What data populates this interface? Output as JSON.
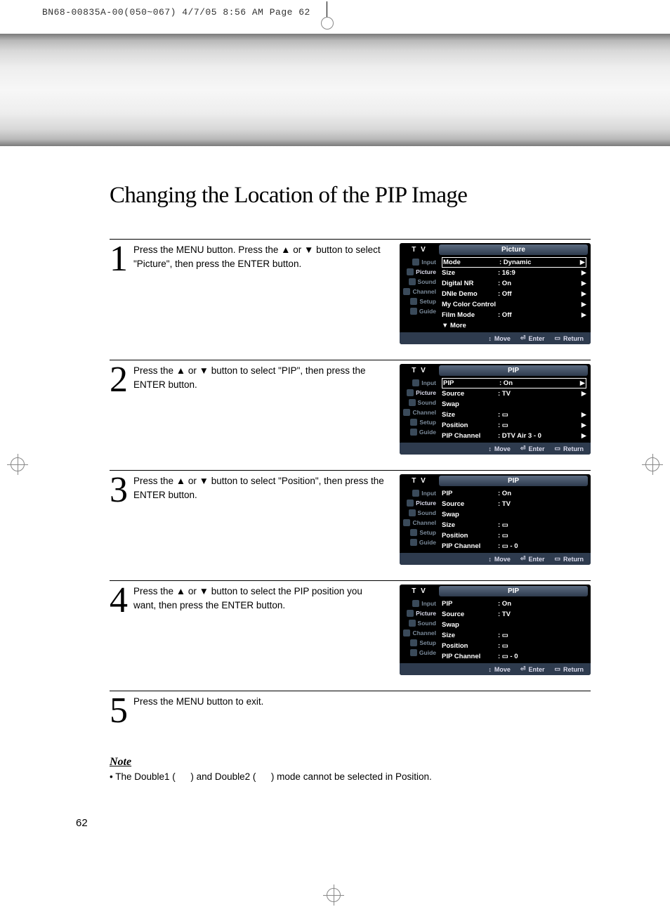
{
  "slug": "BN68-00835A-00(050~067)  4/7/05  8:56 AM  Page 62",
  "title": "Changing the Location of the PIP Image",
  "page_number": "62",
  "steps": [
    {
      "num": "1",
      "text": "Press the MENU button. Press the ▲ or ▼ button to select \"Picture\", then press the ENTER button.",
      "osd": {
        "tv": "T V",
        "title": "Picture",
        "side": [
          "Input",
          "Picture",
          "Sound",
          "Channel",
          "Setup",
          "Guide"
        ],
        "side_active": 1,
        "rows": [
          {
            "label": "Mode",
            "value": ": Dynamic",
            "arrow": "▶",
            "boxed": true
          },
          {
            "label": "Size",
            "value": ": 16:9",
            "arrow": "▶"
          },
          {
            "label": "Digital NR",
            "value": ": On",
            "arrow": "▶"
          },
          {
            "label": "DNIe Demo",
            "value": ": Off",
            "arrow": "▶"
          },
          {
            "label": "My Color Control",
            "value": "",
            "arrow": "▶"
          },
          {
            "label": "Film Mode",
            "value": ": Off",
            "arrow": "▶"
          },
          {
            "label": "▼ More",
            "value": "",
            "arrow": ""
          }
        ],
        "footer": [
          "Move",
          "Enter",
          "Return"
        ]
      }
    },
    {
      "num": "2",
      "text": "Press the ▲ or ▼ button to select \"PIP\", then press the ENTER button.",
      "osd": {
        "tv": "T V",
        "title": "PIP",
        "side": [
          "Input",
          "Picture",
          "Sound",
          "Channel",
          "Setup",
          "Guide"
        ],
        "side_active": 1,
        "rows": [
          {
            "label": "PIP",
            "value": ": On",
            "arrow": "▶",
            "boxed": true
          },
          {
            "label": "Source",
            "value": ": TV",
            "arrow": "▶"
          },
          {
            "label": "Swap",
            "value": "",
            "arrow": ""
          },
          {
            "label": "Size",
            "value": ": ▭",
            "arrow": "▶"
          },
          {
            "label": "Position",
            "value": ": ▭",
            "arrow": "▶"
          },
          {
            "label": "PIP Channel",
            "value": ": DTV Air 3 - 0",
            "arrow": "▶"
          }
        ],
        "footer": [
          "Move",
          "Enter",
          "Return"
        ]
      }
    },
    {
      "num": "3",
      "text": "Press the ▲ or ▼ button to select \"Position\", then press the ENTER button.",
      "osd": {
        "tv": "T V",
        "title": "PIP",
        "side": [
          "Input",
          "Picture",
          "Sound",
          "Channel",
          "Setup",
          "Guide"
        ],
        "side_active": 1,
        "rows": [
          {
            "label": "PIP",
            "value": ": On",
            "arrow": ""
          },
          {
            "label": "Source",
            "value": ": TV",
            "arrow": ""
          },
          {
            "label": "Swap",
            "value": "",
            "arrow": ""
          },
          {
            "label": "Size",
            "value": ": ▭",
            "arrow": ""
          },
          {
            "label": "Position",
            "value": ": ▭",
            "arrow": ""
          },
          {
            "label": "PIP Channel",
            "value": ": ▭ - 0",
            "arrow": ""
          }
        ],
        "footer": [
          "Move",
          "Enter",
          "Return"
        ]
      }
    },
    {
      "num": "4",
      "text": "Press the ▲ or ▼ button to select the PIP position you want, then press the ENTER button.",
      "osd": {
        "tv": "T V",
        "title": "PIP",
        "side": [
          "Input",
          "Picture",
          "Sound",
          "Channel",
          "Setup",
          "Guide"
        ],
        "side_active": 1,
        "rows": [
          {
            "label": "PIP",
            "value": ": On",
            "arrow": ""
          },
          {
            "label": "Source",
            "value": ": TV",
            "arrow": ""
          },
          {
            "label": "Swap",
            "value": "",
            "arrow": ""
          },
          {
            "label": "Size",
            "value": ": ▭",
            "arrow": ""
          },
          {
            "label": "Position",
            "value": ": ▭",
            "arrow": ""
          },
          {
            "label": "PIP Channel",
            "value": ": ▭ - 0",
            "arrow": ""
          }
        ],
        "footer": [
          "Move",
          "Enter",
          "Return"
        ]
      }
    },
    {
      "num": "5",
      "text": "Press the MENU button to exit.",
      "osd": null
    }
  ],
  "note": {
    "heading": "Note",
    "text_parts": [
      "• The Double1 (",
      ") and Double2 (",
      ") mode cannot be selected in Position."
    ]
  }
}
